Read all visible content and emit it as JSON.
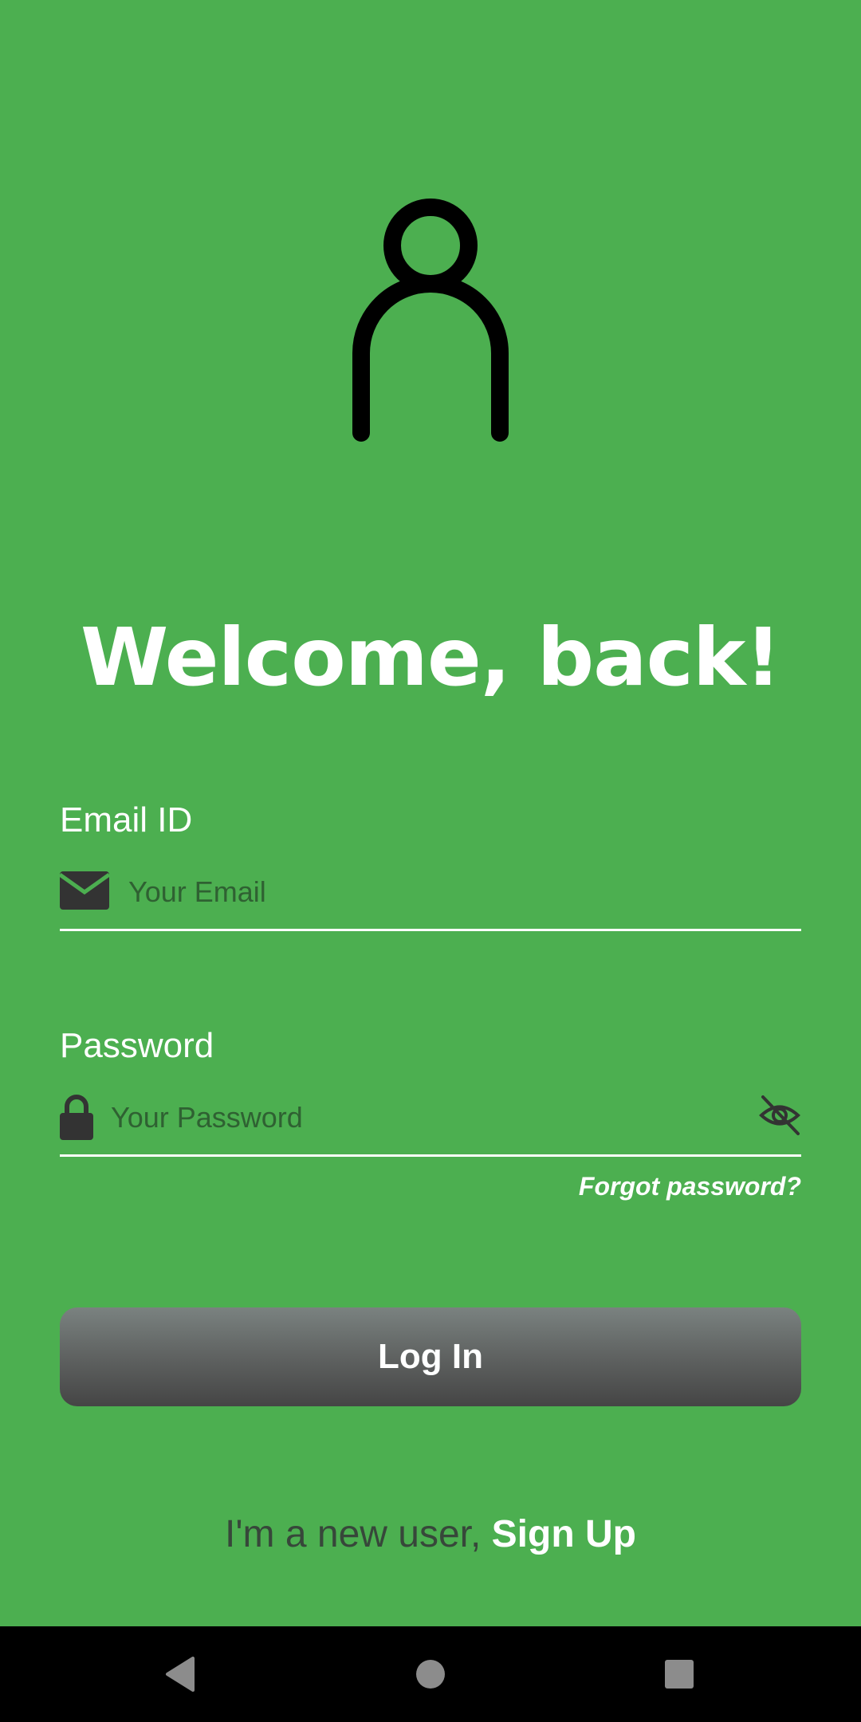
{
  "app": {
    "welcome_title": "Welcome, back!"
  },
  "avatar": {
    "icon": "user-outline-icon"
  },
  "email": {
    "label": "Email ID",
    "placeholder": "Your Email",
    "value": "",
    "icon": "envelope-icon"
  },
  "password": {
    "label": "Password",
    "placeholder": "Your Password",
    "value": "",
    "icon": "lock-icon",
    "visibility_icon": "eye-slash-icon"
  },
  "forgot_password": "Forgot password?",
  "login_button": "Log In",
  "signup": {
    "prompt": "I'm a new user, ",
    "link": "Sign Up"
  },
  "navbar": {
    "back_icon": "back-triangle-icon",
    "home_icon": "home-circle-icon",
    "recents_icon": "recents-square-icon"
  },
  "colors": {
    "background": "#4caf50",
    "text_primary": "#ffffff",
    "button_top": "#7a8280",
    "button_bottom": "#454545",
    "signup_prompt": "#37473a",
    "icon_dark": "#333333"
  }
}
